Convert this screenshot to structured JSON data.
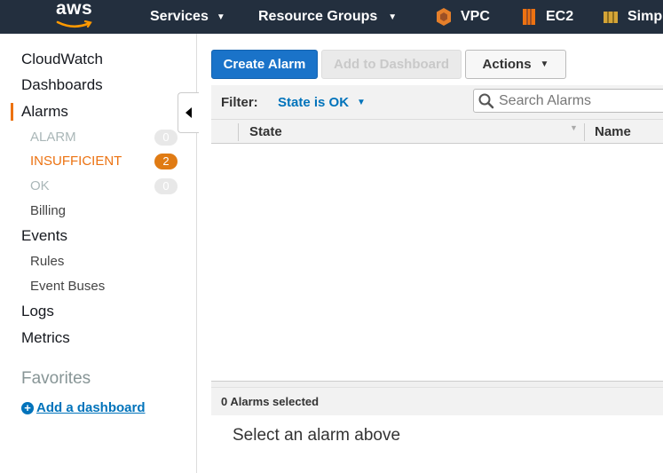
{
  "topnav": {
    "logo": "aws",
    "services": "Services",
    "resource_groups": "Resource Groups",
    "vpc": "VPC",
    "ec2": "EC2",
    "simple": "Simp",
    "colors": {
      "bar": "#232f3e",
      "vpc_icon": "#e57f2a",
      "ec2_icon": "#ec7211",
      "simple_icon": "#d4a437"
    }
  },
  "sidebar": {
    "cloudwatch": "CloudWatch",
    "dashboards": "Dashboards",
    "alarms": "Alarms",
    "alarm_state": {
      "label": "ALARM",
      "count": "0"
    },
    "insufficient_state": {
      "label": "INSUFFICIENT",
      "count": "2"
    },
    "ok_state": {
      "label": "OK",
      "count": "0"
    },
    "billing": "Billing",
    "events": "Events",
    "rules": "Rules",
    "event_buses": "Event Buses",
    "logs": "Logs",
    "metrics": "Metrics",
    "favorites": "Favorites",
    "add_dashboard": "Add a dashboard"
  },
  "toolbar": {
    "create_alarm": "Create Alarm",
    "add_to_dashboard": "Add to Dashboard",
    "actions": "Actions"
  },
  "filter": {
    "label": "Filter:",
    "value": "State is OK",
    "search_placeholder": "Search Alarms"
  },
  "table": {
    "columns": [
      "State",
      "Name"
    ],
    "rows": []
  },
  "details": {
    "selected_count": "0 Alarms selected",
    "empty_message": "Select an alarm above"
  }
}
